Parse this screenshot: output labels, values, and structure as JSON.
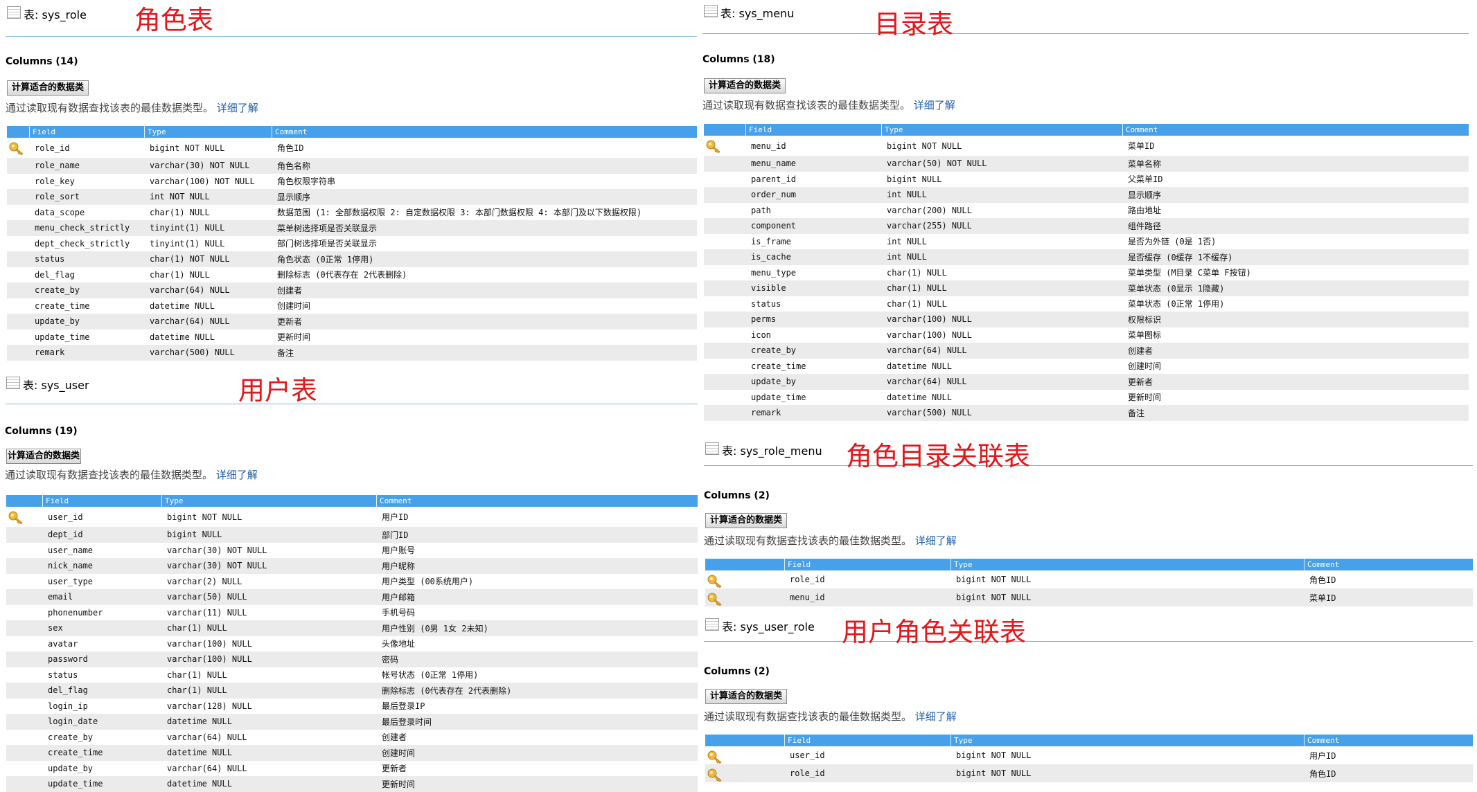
{
  "common": {
    "calc_button": "计算适合的数据类",
    "description": "通过读取现有数据查找该表的最佳数据类型。",
    "learn_more": "详细了解",
    "headers": {
      "field": "Field",
      "type": "Type",
      "comment": "Comment"
    }
  },
  "panels": [
    {
      "table_label": "表: sys_role",
      "annotation": "角色表",
      "columns_label": "Columns (14)",
      "rows": [
        {
          "field": "role_id",
          "type": "bigint NOT NULL",
          "comment": "角色ID",
          "key": true
        },
        {
          "field": "role_name",
          "type": "varchar(30) NOT NULL",
          "comment": "角色名称"
        },
        {
          "field": "role_key",
          "type": "varchar(100) NOT NULL",
          "comment": "角色权限字符串"
        },
        {
          "field": "role_sort",
          "type": "int NOT NULL",
          "comment": "显示顺序"
        },
        {
          "field": "data_scope",
          "type": "char(1) NULL",
          "comment": "数据范围 (1: 全部数据权限 2: 自定数据权限 3: 本部门数据权限 4: 本部门及以下数据权限)"
        },
        {
          "field": "menu_check_strictly",
          "type": "tinyint(1) NULL",
          "comment": "菜单树选择项是否关联显示"
        },
        {
          "field": "dept_check_strictly",
          "type": "tinyint(1) NULL",
          "comment": "部门树选择项是否关联显示"
        },
        {
          "field": "status",
          "type": "char(1) NOT NULL",
          "comment": "角色状态 (0正常 1停用)"
        },
        {
          "field": "del_flag",
          "type": "char(1) NULL",
          "comment": "删除标志 (0代表存在 2代表删除)"
        },
        {
          "field": "create_by",
          "type": "varchar(64) NULL",
          "comment": "创建者"
        },
        {
          "field": "create_time",
          "type": "datetime NULL",
          "comment": "创建时间"
        },
        {
          "field": "update_by",
          "type": "varchar(64) NULL",
          "comment": "更新者"
        },
        {
          "field": "update_time",
          "type": "datetime NULL",
          "comment": "更新时间"
        },
        {
          "field": "remark",
          "type": "varchar(500) NULL",
          "comment": "备注"
        }
      ]
    },
    {
      "table_label": "表: sys_user",
      "annotation": "用户表",
      "columns_label": "Columns (19)",
      "rows": [
        {
          "field": "user_id",
          "type": "bigint NOT NULL",
          "comment": "用户ID",
          "key": true
        },
        {
          "field": "dept_id",
          "type": "bigint NULL",
          "comment": "部门ID"
        },
        {
          "field": "user_name",
          "type": "varchar(30) NOT NULL",
          "comment": "用户账号"
        },
        {
          "field": "nick_name",
          "type": "varchar(30) NOT NULL",
          "comment": "用户昵称"
        },
        {
          "field": "user_type",
          "type": "varchar(2) NULL",
          "comment": "用户类型 (00系统用户)"
        },
        {
          "field": "email",
          "type": "varchar(50) NULL",
          "comment": "用户邮箱"
        },
        {
          "field": "phonenumber",
          "type": "varchar(11) NULL",
          "comment": "手机号码"
        },
        {
          "field": "sex",
          "type": "char(1) NULL",
          "comment": "用户性别 (0男 1女 2未知)"
        },
        {
          "field": "avatar",
          "type": "varchar(100) NULL",
          "comment": "头像地址"
        },
        {
          "field": "password",
          "type": "varchar(100) NULL",
          "comment": "密码"
        },
        {
          "field": "status",
          "type": "char(1) NULL",
          "comment": "帐号状态 (0正常 1停用)"
        },
        {
          "field": "del_flag",
          "type": "char(1) NULL",
          "comment": "删除标志 (0代表存在 2代表删除)"
        },
        {
          "field": "login_ip",
          "type": "varchar(128) NULL",
          "comment": "最后登录IP"
        },
        {
          "field": "login_date",
          "type": "datetime NULL",
          "comment": "最后登录时间"
        },
        {
          "field": "create_by",
          "type": "varchar(64) NULL",
          "comment": "创建者"
        },
        {
          "field": "create_time",
          "type": "datetime NULL",
          "comment": "创建时间"
        },
        {
          "field": "update_by",
          "type": "varchar(64) NULL",
          "comment": "更新者"
        },
        {
          "field": "update_time",
          "type": "datetime NULL",
          "comment": "更新时间"
        }
      ]
    },
    {
      "table_label": "表: sys_menu",
      "annotation": "目录表",
      "columns_label": "Columns (18)",
      "rows": [
        {
          "field": "menu_id",
          "type": "bigint NOT NULL",
          "comment": "菜单ID",
          "key": true
        },
        {
          "field": "menu_name",
          "type": "varchar(50) NOT NULL",
          "comment": "菜单名称"
        },
        {
          "field": "parent_id",
          "type": "bigint NULL",
          "comment": "父菜单ID"
        },
        {
          "field": "order_num",
          "type": "int NULL",
          "comment": "显示顺序"
        },
        {
          "field": "path",
          "type": "varchar(200) NULL",
          "comment": "路由地址"
        },
        {
          "field": "component",
          "type": "varchar(255) NULL",
          "comment": "组件路径"
        },
        {
          "field": "is_frame",
          "type": "int NULL",
          "comment": "是否为外链 (0是 1否)"
        },
        {
          "field": "is_cache",
          "type": "int NULL",
          "comment": "是否缓存 (0缓存 1不缓存)"
        },
        {
          "field": "menu_type",
          "type": "char(1) NULL",
          "comment": "菜单类型 (M目录 C菜单 F按钮)"
        },
        {
          "field": "visible",
          "type": "char(1) NULL",
          "comment": "菜单状态 (0显示 1隐藏)"
        },
        {
          "field": "status",
          "type": "char(1) NULL",
          "comment": "菜单状态 (0正常 1停用)"
        },
        {
          "field": "perms",
          "type": "varchar(100) NULL",
          "comment": "权限标识"
        },
        {
          "field": "icon",
          "type": "varchar(100) NULL",
          "comment": "菜单图标"
        },
        {
          "field": "create_by",
          "type": "varchar(64) NULL",
          "comment": "创建者"
        },
        {
          "field": "create_time",
          "type": "datetime NULL",
          "comment": "创建时间"
        },
        {
          "field": "update_by",
          "type": "varchar(64) NULL",
          "comment": "更新者"
        },
        {
          "field": "update_time",
          "type": "datetime NULL",
          "comment": "更新时间"
        },
        {
          "field": "remark",
          "type": "varchar(500) NULL",
          "comment": "备注"
        }
      ]
    },
    {
      "table_label": "表: sys_role_menu",
      "annotation": "角色目录关联表",
      "columns_label": "Columns (2)",
      "rows": [
        {
          "field": "role_id",
          "type": "bigint NOT NULL",
          "comment": "角色ID",
          "key": true
        },
        {
          "field": "menu_id",
          "type": "bigint NOT NULL",
          "comment": "菜单ID",
          "key": true
        }
      ]
    },
    {
      "table_label": "表: sys_user_role",
      "annotation": "用户角色关联表",
      "columns_label": "Columns (2)",
      "rows": [
        {
          "field": "user_id",
          "type": "bigint NOT NULL",
          "comment": "用户ID",
          "key": true
        },
        {
          "field": "role_id",
          "type": "bigint NOT NULL",
          "comment": "角色ID",
          "key": true
        }
      ]
    }
  ]
}
